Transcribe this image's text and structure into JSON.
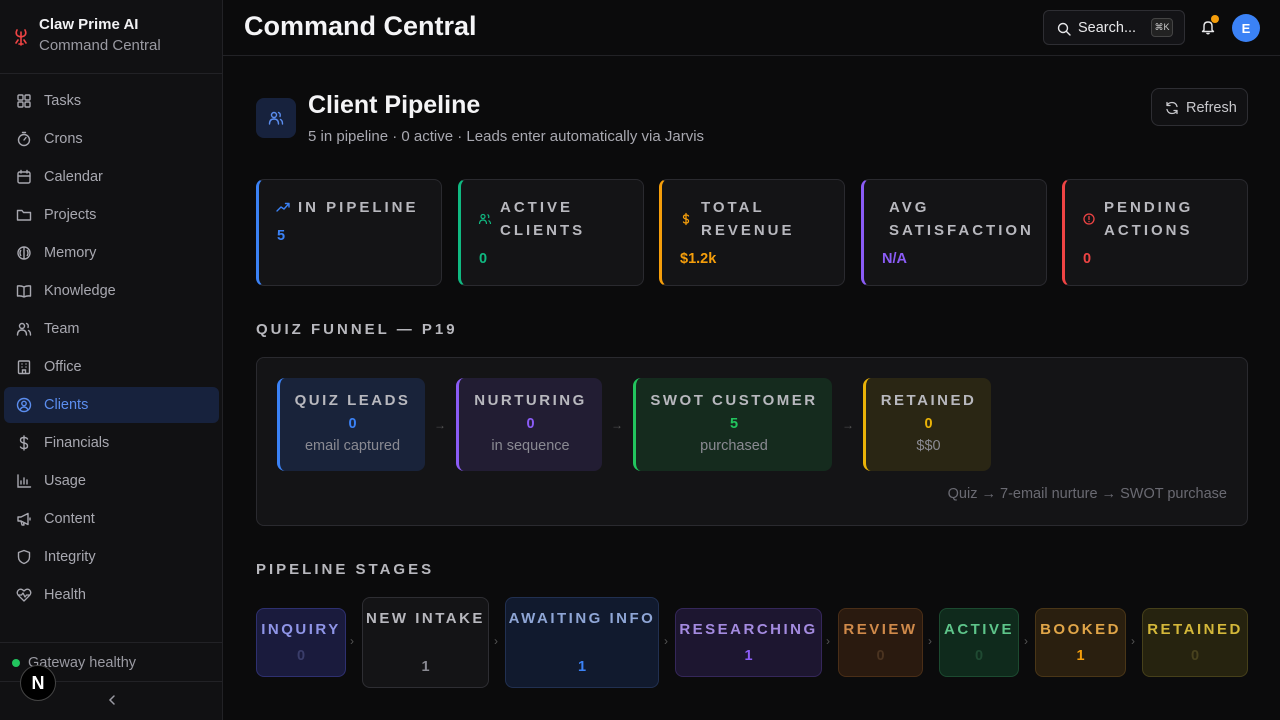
{
  "app": {
    "name": "Claw Prime AI",
    "subtitle": "Command Central"
  },
  "sidebar": {
    "items": [
      {
        "label": "Tasks",
        "icon": "grid-icon"
      },
      {
        "label": "Crons",
        "icon": "timer-icon"
      },
      {
        "label": "Calendar",
        "icon": "calendar-icon"
      },
      {
        "label": "Projects",
        "icon": "folder-icon"
      },
      {
        "label": "Memory",
        "icon": "brain-icon"
      },
      {
        "label": "Knowledge",
        "icon": "book-icon"
      },
      {
        "label": "Team",
        "icon": "users-icon"
      },
      {
        "label": "Office",
        "icon": "building-icon"
      },
      {
        "label": "Clients",
        "icon": "user-circle-icon"
      },
      {
        "label": "Financials",
        "icon": "dollar-icon"
      },
      {
        "label": "Usage",
        "icon": "bar-chart-icon"
      },
      {
        "label": "Content",
        "icon": "megaphone-icon"
      },
      {
        "label": "Integrity",
        "icon": "shield-icon"
      },
      {
        "label": "Health",
        "icon": "heart-pulse-icon"
      }
    ],
    "active": "Clients",
    "gateway_status": "Gateway healthy",
    "badge_letter": "N"
  },
  "header": {
    "title": "Command Central",
    "search_label": "Search...",
    "search_shortcut": "⌘K",
    "avatar_letter": "E",
    "notification_color": "#f59e0b"
  },
  "section": {
    "title": "Client Pipeline",
    "subtitle": "5 in pipeline · 0 active · Leads enter automatically via Jarvis",
    "refresh_label": "Refresh"
  },
  "stats": [
    {
      "label": "In Pipeline",
      "value": "5",
      "color": "#3b82f6"
    },
    {
      "label": "Active Clients",
      "value": "0",
      "color": "#10b981"
    },
    {
      "label": "Total Revenue",
      "value": "$1.2k",
      "color": "#f59e0b"
    },
    {
      "label": "Avg Satisfaction",
      "value": "N/A",
      "color": "#8b5cf6"
    },
    {
      "label": "Pending Actions",
      "value": "0",
      "color": "#ef4444"
    }
  ],
  "funnel": {
    "title": "QUIZ FUNNEL — P19",
    "stages": [
      {
        "label": "QUIZ LEADS",
        "value": "0",
        "desc": "email captured",
        "color": "#3b82f6"
      },
      {
        "label": "NURTURING",
        "value": "0",
        "desc": "in sequence",
        "color": "#8b5cf6"
      },
      {
        "label": "SWOT CUSTOMER",
        "value": "5",
        "desc": "purchased",
        "color": "#22c55e"
      },
      {
        "label": "RETAINED",
        "value": "0",
        "desc": "$$0",
        "color": "#eab308"
      }
    ],
    "arrow": "→",
    "note": "Quiz → 7-email nurture → SWOT purchase"
  },
  "pipeline": {
    "title": "PIPELINE STAGES",
    "arrow": "›",
    "stages": [
      {
        "label": "INQUIRY",
        "value": "0"
      },
      {
        "label": "NEW INTAKE",
        "value": "1"
      },
      {
        "label": "AWAITING INFO",
        "value": "1"
      },
      {
        "label": "RESEARCHING",
        "value": "1"
      },
      {
        "label": "REVIEW",
        "value": "0"
      },
      {
        "label": "ACTIVE",
        "value": "0"
      },
      {
        "label": "BOOKED",
        "value": "1"
      },
      {
        "label": "RETAINED",
        "value": "0"
      }
    ]
  }
}
